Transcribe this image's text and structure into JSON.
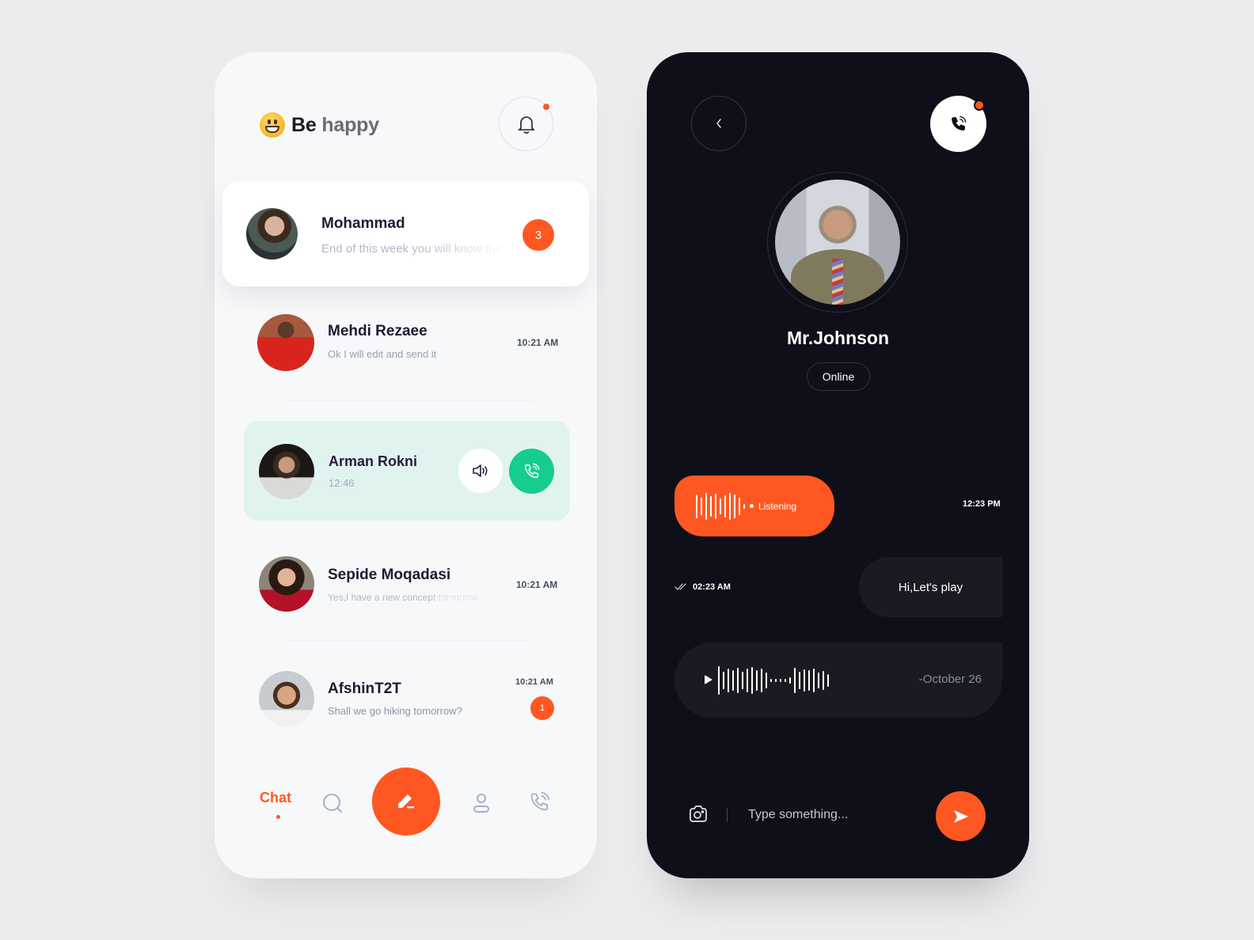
{
  "colors": {
    "accent": "#ff5722",
    "green": "#17cc8f",
    "light_bg": "#f7f8fa",
    "dark_bg": "#0e0f18"
  },
  "list_panel": {
    "brand": {
      "emoji": "grinning-face",
      "word1": "Be",
      "word2": "happy"
    },
    "notification": {
      "icon": "bell-icon",
      "has_unread": true
    },
    "chats": [
      {
        "name": "Mohammad",
        "preview": "End of this week you will know the",
        "unread": "3",
        "highlighted": true
      },
      {
        "name": "Mehdi Rezaee",
        "preview": "Ok I will edit and send it",
        "time": "10:21 AM"
      },
      {
        "name": "Arman Rokni",
        "call_duration": "12:46",
        "in_call": true
      },
      {
        "name": "Sepide Moqadasi",
        "preview": "Yes,I have a new concept tomorrow",
        "time": "10:21 AM"
      },
      {
        "name": "AfshinT2T",
        "preview": "Shall we go hiking tomorrow?",
        "time": "10:21 AM",
        "unread": "1"
      }
    ],
    "nav": {
      "active_label": "Chat",
      "items": [
        "chat",
        "search-icon",
        "compose-icon",
        "profile-icon",
        "calls-icon"
      ]
    }
  },
  "conversation_panel": {
    "contact_name": "Mr.Johnson",
    "status": "Online",
    "messages": [
      {
        "type": "voice",
        "direction": "outgoing",
        "state": "Listening",
        "time": "12:23 PM"
      },
      {
        "type": "text",
        "direction": "incoming",
        "text": "Hi,Let's play",
        "time": "02:23 AM",
        "read": true
      },
      {
        "type": "audio",
        "direction": "incoming",
        "date": "-October 26"
      }
    ],
    "composer": {
      "placeholder": "Type something..."
    }
  }
}
